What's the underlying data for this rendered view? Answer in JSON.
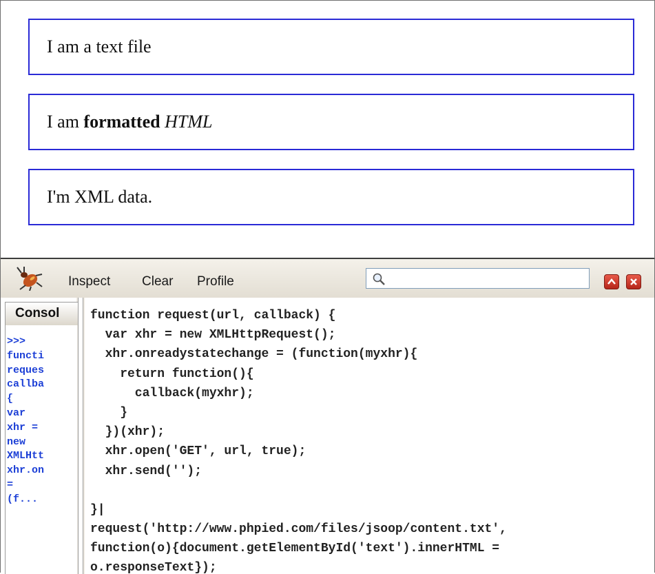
{
  "content": {
    "box1": {
      "text": "I am a text file"
    },
    "box2": {
      "prefix": "I am ",
      "bold": "formatted",
      "space": " ",
      "italic": "HTML"
    },
    "box3": {
      "text": "I'm XML data."
    }
  },
  "firebug": {
    "toolbar": {
      "inspect_label": "Inspect",
      "clear_label": "Clear",
      "profile_label": "Profile",
      "search_value": "",
      "logo_icon": "firebug-icon",
      "search_icon": "magnifier-icon",
      "restore_icon": "chevron-up-icon",
      "close_icon": "close-icon"
    },
    "console_tab_label": "Consol",
    "history": [
      ">>>",
      "functi",
      "reques",
      "callba",
      "{",
      "var",
      "xhr =",
      "new",
      "XMLHtt",
      "xhr.on",
      "=",
      "(f..."
    ],
    "code_lines": [
      "function request(url, callback) {",
      "  var xhr = new XMLHttpRequest();",
      "  xhr.onreadystatechange = (function(myxhr){",
      "    return function(){",
      "      callback(myxhr);",
      "    }",
      "  })(xhr);",
      "  xhr.open('GET', url, true);",
      "  xhr.send('');",
      "",
      "}|",
      "request('http://www.phpied.com/files/jsoop/content.txt',",
      "function(o){document.getElementById('text').innerHTML =",
      "o.responseText});"
    ]
  },
  "colors": {
    "box_border": "#2a2ad6",
    "history_text": "#1c3fd6",
    "panel_bg": "#efebe3"
  }
}
